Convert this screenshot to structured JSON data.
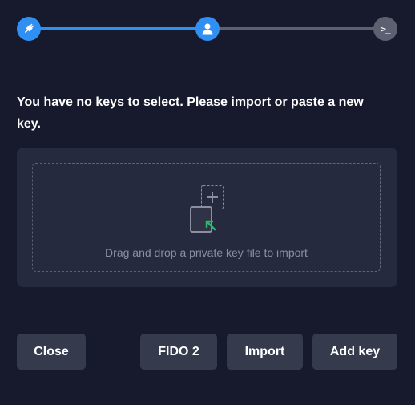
{
  "stepper": {
    "steps": [
      {
        "icon": "plug-icon",
        "state": "complete"
      },
      {
        "icon": "user-icon",
        "state": "active"
      },
      {
        "icon": "terminal-icon",
        "state": "pending",
        "glyph": ">_"
      }
    ],
    "colors": {
      "active": "#2f8ff3",
      "inactive": "#5c6070"
    }
  },
  "message": "You have no keys to select. Please import or paste a new key.",
  "dropzone": {
    "icon": "file-drop-icon",
    "text": "Drag and drop a private key file to import"
  },
  "buttons": {
    "close": "Close",
    "fido2": "FIDO 2",
    "import": "Import",
    "add_key": "Add key"
  },
  "colors": {
    "background": "#161a2c",
    "panel": "#262a3e",
    "button": "#353a4d",
    "accent_green": "#2fb56a"
  }
}
